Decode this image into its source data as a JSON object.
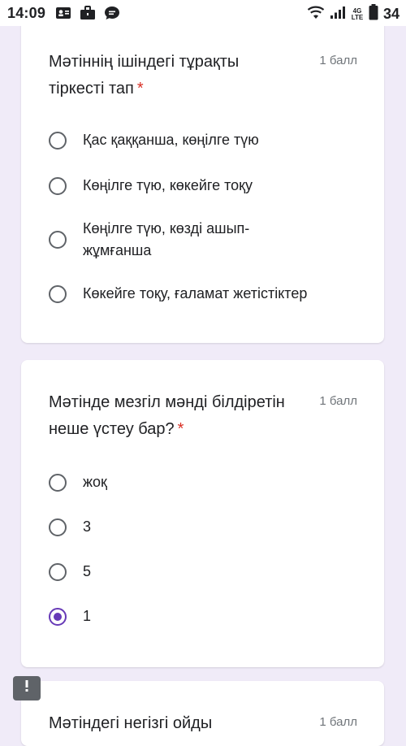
{
  "status_bar": {
    "time": "14:09",
    "network": "4G LTE",
    "battery": "34"
  },
  "questions": [
    {
      "title": "Мәтіннің ішіндегі тұрақты тіркесті тап",
      "required_mark": "*",
      "points": "1 балл",
      "options": [
        {
          "label": "Қас қаққанша, көңілге түю",
          "selected": false
        },
        {
          "label": "Көңілге түю, көкейге тоқу",
          "selected": false
        },
        {
          "label": "Көңілге түю, көзді ашып-жұмғанша",
          "selected": false
        },
        {
          "label": "Көкейге тоқу, ғаламат жетістіктер",
          "selected": false
        }
      ]
    },
    {
      "title": "Мәтінде мезгіл мәнді білдіретін неше үстеу бар?",
      "required_mark": "*",
      "points": "1 балл",
      "options": [
        {
          "label": "жоқ",
          "selected": false
        },
        {
          "label": "3",
          "selected": false
        },
        {
          "label": "5",
          "selected": false
        },
        {
          "label": "1",
          "selected": true
        }
      ]
    },
    {
      "title": "Мәтіндегі негізгі ойды",
      "points": "1 балл"
    }
  ],
  "colors": {
    "background": "#f0ebf8",
    "accent": "#673ab7",
    "required": "#d93025"
  },
  "icons": {
    "alert": "report-problem-icon"
  }
}
